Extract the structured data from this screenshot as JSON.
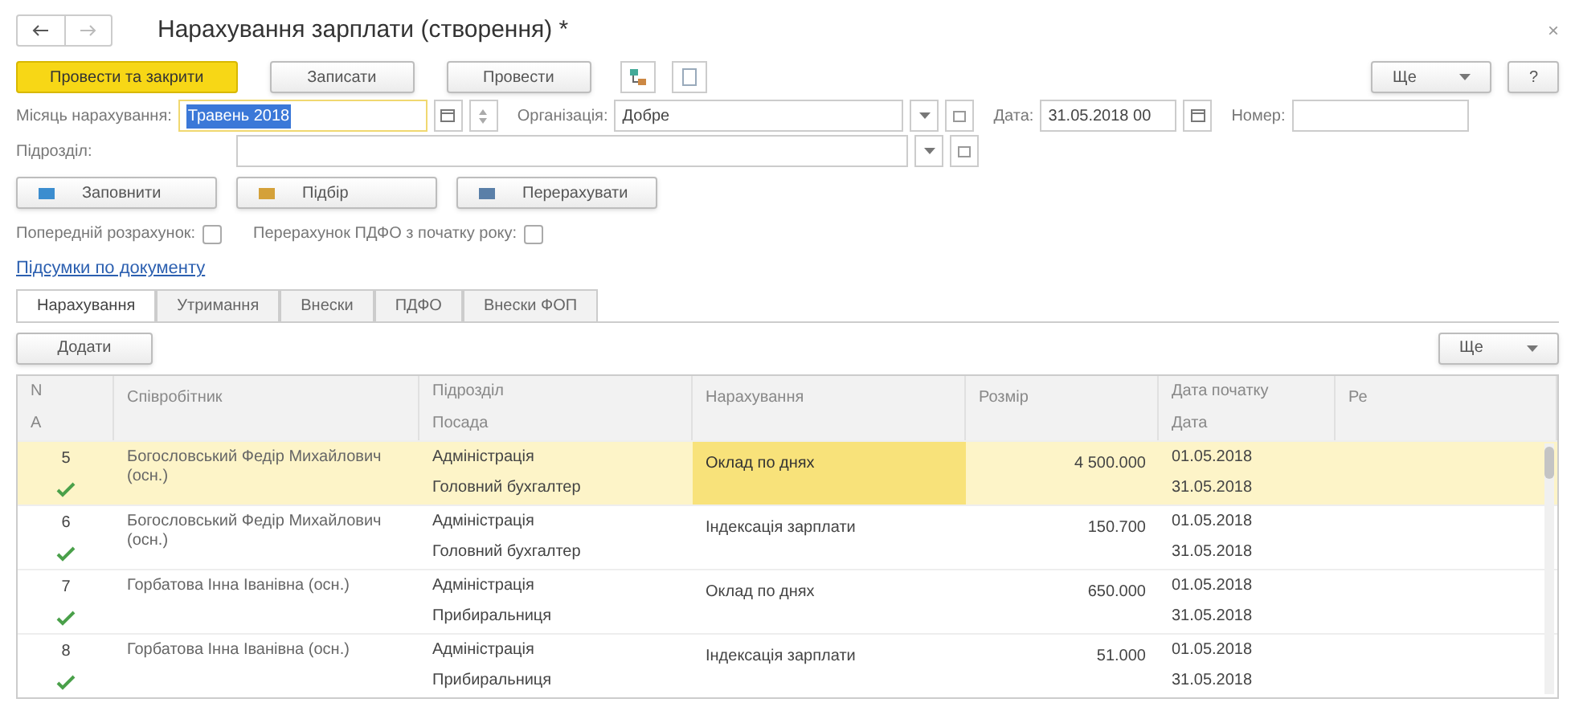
{
  "window": {
    "title": "Нарахування зарплати (створення) *",
    "close": "×"
  },
  "toolbar": {
    "primary": "Провести та закрити",
    "buttons": [
      "Записати",
      "Провести"
    ],
    "more": "Ще",
    "help": "?"
  },
  "fields": {
    "month": {
      "label": "Місяць нарахування:",
      "value": "Травень 2018"
    },
    "organization": {
      "label": "Організація:",
      "value": "Добре"
    },
    "date": {
      "label": "Дата:",
      "value": "31.05.2018 00"
    },
    "number": {
      "label": "Номер:"
    },
    "department": {
      "label": "Підрозділ:"
    }
  },
  "actions": [
    "Заповнити",
    "Підбір",
    "Перерахувати"
  ],
  "checkboxes": [
    {
      "label": "Попередній розрахунок:",
      "checked": false
    },
    {
      "label": "Перерахунок ПДФО з початку року:",
      "checked": false
    }
  ],
  "totals_link": "Підсумки по документу",
  "tabs": [
    {
      "label": "Нарахування",
      "selected": true
    },
    {
      "label": "Утримання",
      "selected": false
    },
    {
      "label": "Внески",
      "selected": false
    },
    {
      "label": "ПДФО",
      "selected": false
    },
    {
      "label": "Внески ФОП",
      "selected": false
    }
  ],
  "table_toolbar": {
    "add": "Додати",
    "more": "Ще"
  },
  "table": {
    "columns": [
      {
        "top": "N",
        "bottom": "A"
      },
      {
        "top": "Співробітник"
      },
      {
        "top": "Підрозділ",
        "bottom": "Посада"
      },
      {
        "top": "Нарахування"
      },
      {
        "top": "Розмір"
      },
      {
        "top": "Дата початку",
        "bottom": "Дата"
      },
      {
        "top": "Ре"
      }
    ],
    "rows": [
      {
        "n": "5",
        "employee": "Богословський Федір Михайлович (осн.)",
        "department": "Адміністрація",
        "position": "Головний бухгалтер",
        "accrual": "Оклад по днях",
        "amount": "4 500.000",
        "start": "01.05.2018",
        "end": "31.05.2018",
        "checked": true,
        "selected": true
      },
      {
        "n": "6",
        "employee": "Богословський Федір Михайлович (осн.)",
        "department": "Адміністрація",
        "position": "Головний бухгалтер",
        "accrual": "Індексація зарплати",
        "amount": "150.700",
        "start": "01.05.2018",
        "end": "31.05.2018",
        "checked": true,
        "selected": false
      },
      {
        "n": "7",
        "employee": "Горбатова Інна Іванівна (осн.)",
        "department": "Адміністрація",
        "position": "Прибиральниця",
        "accrual": "Оклад по днях",
        "amount": "650.000",
        "start": "01.05.2018",
        "end": "31.05.2018",
        "checked": true,
        "selected": false
      },
      {
        "n": "8",
        "employee": "Горбатова Інна Іванівна (осн.)",
        "department": "Адміністрація",
        "position": "Прибиральниця",
        "accrual": "Індексація зарплати",
        "amount": "51.000",
        "start": "01.05.2018",
        "end": "31.05.2018",
        "checked": true,
        "selected": false
      }
    ]
  }
}
